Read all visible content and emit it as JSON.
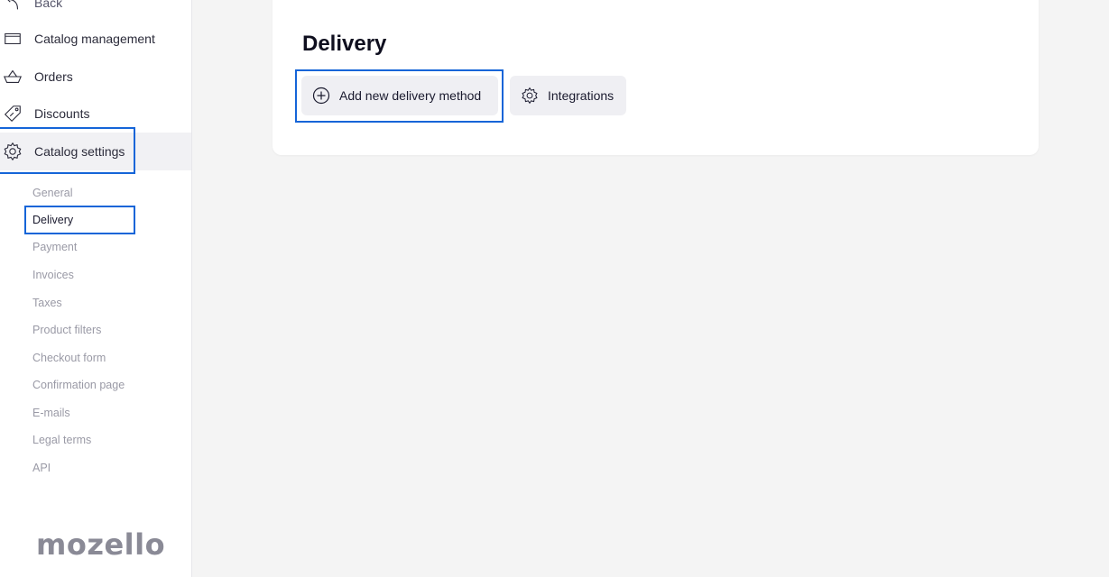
{
  "sidebar": {
    "items": [
      {
        "label": "Back",
        "icon": "back-arrow-icon"
      },
      {
        "label": "Catalog management",
        "icon": "folder-icon"
      },
      {
        "label": "Orders",
        "icon": "basket-icon"
      },
      {
        "label": "Discounts",
        "icon": "tag-icon"
      },
      {
        "label": "Catalog settings",
        "icon": "gear-icon"
      }
    ],
    "subitems": [
      {
        "label": "General"
      },
      {
        "label": "Delivery"
      },
      {
        "label": "Payment"
      },
      {
        "label": "Invoices"
      },
      {
        "label": "Taxes"
      },
      {
        "label": "Product filters"
      },
      {
        "label": "Checkout form"
      },
      {
        "label": "Confirmation page"
      },
      {
        "label": "E-mails"
      },
      {
        "label": "Legal terms"
      },
      {
        "label": "API"
      }
    ],
    "logo": "mozello"
  },
  "main": {
    "title": "Delivery",
    "add_button": "Add new delivery method",
    "integrations_button": "Integrations"
  },
  "colors": {
    "accent_outline": "#1565d8",
    "active_bg": "#f1f1f4",
    "muted_text": "#9a9aa6"
  }
}
